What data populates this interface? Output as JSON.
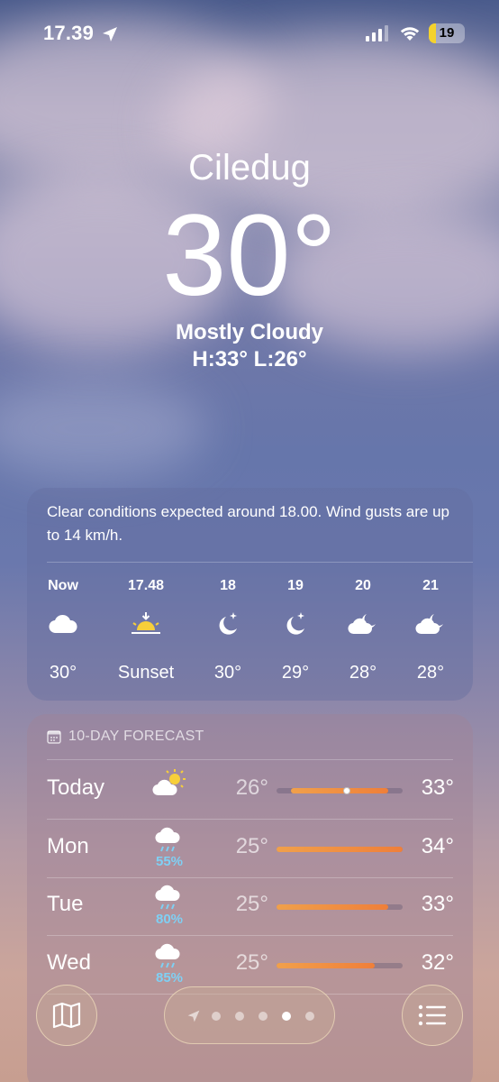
{
  "status_bar": {
    "time": "17.39",
    "battery": "19",
    "battery_level": 0.19
  },
  "current": {
    "city": "Ciledug",
    "temperature": "30°",
    "condition": "Mostly Cloudy",
    "high_low": "H:33°  L:26°"
  },
  "hourly": {
    "summary": "Clear conditions expected around 18.00. Wind gusts are up to 14 km/h.",
    "items": [
      {
        "label": "Now",
        "icon": "cloud-icon",
        "value": "30°"
      },
      {
        "label": "17.48",
        "icon": "sunset-icon",
        "value": "Sunset"
      },
      {
        "label": "18",
        "icon": "moon-stars-icon",
        "value": "30°"
      },
      {
        "label": "19",
        "icon": "moon-stars-icon",
        "value": "29°"
      },
      {
        "label": "20",
        "icon": "cloud-moon-icon",
        "value": "28°"
      },
      {
        "label": "21",
        "icon": "cloud-moon-icon",
        "value": "28°"
      }
    ]
  },
  "daily": {
    "header": "10-DAY FORECAST",
    "temp_scale": [
      25,
      34
    ],
    "days": [
      {
        "day": "Today",
        "icon": "cloud-sun-icon",
        "precip": "",
        "low": "26°",
        "high": "33°",
        "low_value": 26,
        "high_value": 33,
        "current_value": 30
      },
      {
        "day": "Mon",
        "icon": "cloud-rain-icon",
        "precip": "55%",
        "low": "25°",
        "high": "34°",
        "low_value": 25,
        "high_value": 34
      },
      {
        "day": "Tue",
        "icon": "cloud-rain-icon",
        "precip": "80%",
        "low": "25°",
        "high": "33°",
        "low_value": 25,
        "high_value": 33
      },
      {
        "day": "Wed",
        "icon": "cloud-rain-icon",
        "precip": "85%",
        "low": "25°",
        "high": "32°",
        "low_value": 25,
        "high_value": 32
      }
    ]
  },
  "nav": {
    "page_count": 5,
    "active_page": 4
  },
  "colors": {
    "precip": "#7fd0f4",
    "bar_start": "#f0a04b",
    "bar_end": "#ef7f3a",
    "battery": "#f4d22d"
  }
}
